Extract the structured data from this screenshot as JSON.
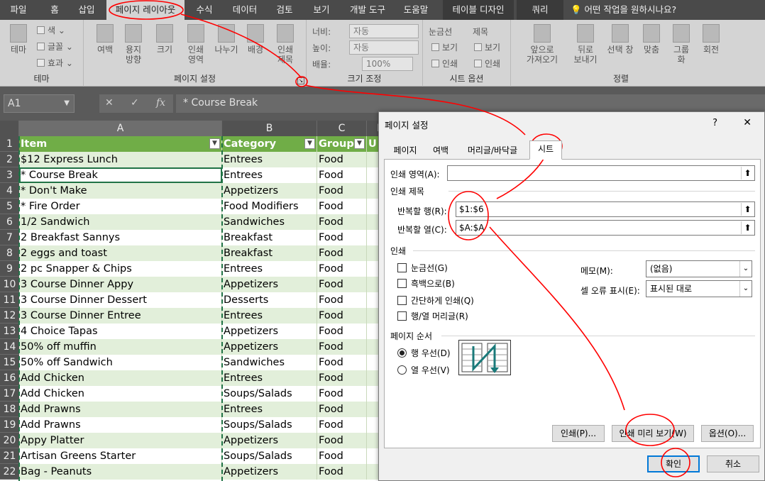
{
  "ribbon_tabs": [
    "파일",
    "홈",
    "삽입",
    "페이지 레이아웃",
    "수식",
    "데이터",
    "검토",
    "보기",
    "개발 도구",
    "도움말",
    "테이블 디자인",
    "쿼리",
    "어떤 작업을 원하시나요?"
  ],
  "ribbon": {
    "theme": {
      "themes": "테마",
      "colors": "색",
      "fonts": "글꼴",
      "effects": "효과",
      "label": "테마"
    },
    "page_setup": {
      "margins": "여백",
      "orientation": "용지\n방향",
      "size": "크기",
      "print_area": "인쇄\n영역",
      "breaks": "나누기",
      "background": "배경",
      "print_titles": "인쇄\n제목",
      "label": "페이지 설정"
    },
    "scale": {
      "width_label": "너비:",
      "width_val": "자동",
      "height_label": "높이:",
      "height_val": "자동",
      "scale_label": "배율:",
      "scale_val": "100%",
      "label": "크기 조정"
    },
    "sheet_options": {
      "gridlines": "눈금선",
      "headings": "제목",
      "view1": "보기",
      "print1": "인쇄",
      "view2": "보기",
      "print2": "인쇄",
      "label": "시트 옵션"
    },
    "arrange": {
      "bring_forward": "앞으로\n가져오기",
      "send_backward": "뒤로\n보내기",
      "selection_pane": "선택 창",
      "align": "맞춤",
      "group": "그룹\n화",
      "rotate": "회전",
      "label": "정렬"
    }
  },
  "formula_bar": {
    "name_box": "A1",
    "formula": "* Course Break",
    "fx": "fx"
  },
  "sheet": {
    "columns": [
      "A",
      "B",
      "C",
      "D"
    ],
    "header": [
      "Item",
      "Category",
      "Group",
      "U"
    ],
    "row_numbers": [
      "1",
      "2",
      "3",
      "4",
      "5",
      "6",
      "7",
      "8",
      "9",
      "10",
      "11",
      "12",
      "13",
      "14",
      "15",
      "16",
      "17",
      "18",
      "19",
      "20",
      "21",
      "22"
    ],
    "rows": [
      [
        "$12 Express Lunch",
        "Entrees",
        "Food"
      ],
      [
        "* Course Break",
        "Entrees",
        "Food"
      ],
      [
        "* Don't Make",
        "Appetizers",
        "Food"
      ],
      [
        "* Fire Order",
        "Food Modifiers",
        "Food"
      ],
      [
        "1/2 Sandwich",
        "Sandwiches",
        "Food"
      ],
      [
        "2 Breakfast Sannys",
        "Breakfast",
        "Food"
      ],
      [
        "2 eggs and toast",
        "Breakfast",
        "Food"
      ],
      [
        "2 pc Snapper & Chips",
        "Entrees",
        "Food"
      ],
      [
        "3 Course Dinner Appy",
        "Appetizers",
        "Food"
      ],
      [
        "3 Course Dinner Dessert",
        "Desserts",
        "Food"
      ],
      [
        "3 Course Dinner Entree",
        "Entrees",
        "Food"
      ],
      [
        "4 Choice Tapas",
        "Appetizers",
        "Food"
      ],
      [
        "50% off muffin",
        "Appetizers",
        "Food"
      ],
      [
        "50% off Sandwich",
        "Sandwiches",
        "Food"
      ],
      [
        "Add Chicken",
        "Entrees",
        "Food"
      ],
      [
        "Add Chicken",
        "Soups/Salads",
        "Food"
      ],
      [
        "Add Prawns",
        "Entrees",
        "Food"
      ],
      [
        "Add Prawns",
        "Soups/Salads",
        "Food"
      ],
      [
        "Appy Platter",
        "Appetizers",
        "Food"
      ],
      [
        "Artisan Greens Starter",
        "Soups/Salads",
        "Food"
      ],
      [
        "Bag - Peanuts",
        "Appetizers",
        "Food"
      ]
    ]
  },
  "dialog": {
    "title": "페이지 설정",
    "help": "?",
    "close": "✕",
    "tabs": [
      "페이지",
      "여백",
      "머리글/바닥글",
      "시트"
    ],
    "print_area_label": "인쇄 영역(A):",
    "print_area_value": "",
    "print_titles_label": "인쇄 제목",
    "rows_repeat_label": "반복할 행(R):",
    "rows_repeat_value": "$1:$6",
    "cols_repeat_label": "반복할 열(C):",
    "cols_repeat_value": "$A:$A",
    "print_section": "인쇄",
    "checkboxes": [
      "눈금선(G)",
      "흑백으로(B)",
      "간단하게 인쇄(Q)",
      "행/열 머리글(R)"
    ],
    "comments_label": "메모(M):",
    "comments_value": "(없음)",
    "cell_errors_label": "셀 오류 표시(E):",
    "cell_errors_value": "표시된 대로",
    "page_order_label": "페이지 순서",
    "radio_down_then_over": "행 우선(D)",
    "radio_over_then_down": "열 우선(V)",
    "btn_print": "인쇄(P)...",
    "btn_preview": "인쇄 미리 보기(W)",
    "btn_options": "옵션(O)...",
    "btn_ok": "확인",
    "btn_cancel": "취소"
  },
  "colors": {
    "table_header": "#70ad47",
    "band": "#e2efda",
    "annotation": "#ff0000"
  }
}
